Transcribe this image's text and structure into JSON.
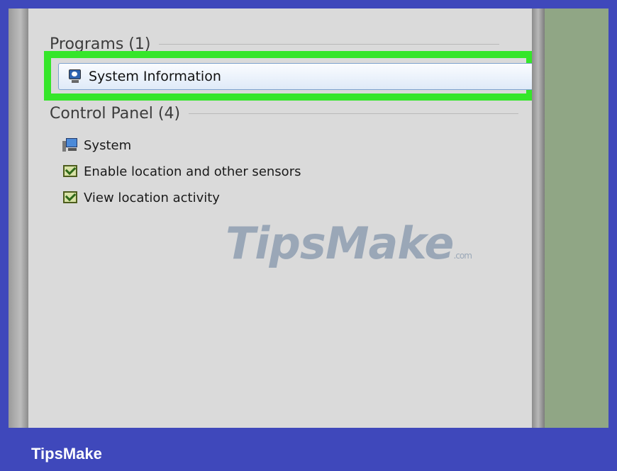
{
  "programs": {
    "header": "Programs (1)",
    "items": [
      {
        "label": "System Information",
        "icon": "system-information-icon"
      }
    ]
  },
  "control_panel": {
    "header": "Control Panel (4)",
    "items": [
      {
        "label": "System",
        "icon": "computer-icon"
      },
      {
        "label": "Enable location and other sensors",
        "icon": "sensor-icon"
      },
      {
        "label": "View location activity",
        "icon": "sensor-icon"
      }
    ]
  },
  "watermark": {
    "text": "TipsMake",
    "suffix": ".com"
  },
  "caption": "TipsMake",
  "colors": {
    "background": "#3f48bb",
    "highlight": "#35e62a",
    "results_bg": "#dadada",
    "right_pane": "#90a685"
  }
}
